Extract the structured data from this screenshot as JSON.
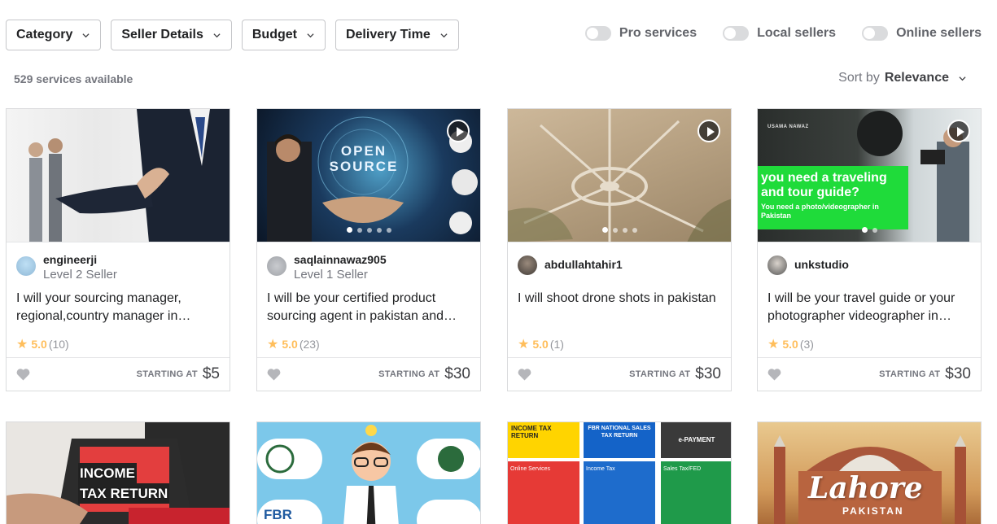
{
  "filters": [
    {
      "label": "Category"
    },
    {
      "label": "Seller Details"
    },
    {
      "label": "Budget"
    },
    {
      "label": "Delivery Time"
    }
  ],
  "toggles": [
    {
      "label": "Pro services"
    },
    {
      "label": "Local sellers"
    },
    {
      "label": "Online sellers"
    }
  ],
  "results_count": "529 services available",
  "sort": {
    "prefix": "Sort by",
    "value": "Relevance"
  },
  "price_prefix": "STARTING AT",
  "cards": [
    {
      "seller": "engineerji",
      "level": "Level 2 Seller",
      "title": "I will your sourcing manager, regional,country manager in pakistan",
      "score": "5.0",
      "count": "(10)",
      "price": "$5"
    },
    {
      "seller": "saqlainnawaz905",
      "level": "Level 1 Seller",
      "title": "I will be your certified product sourcing agent in pakistan and china",
      "score": "5.0",
      "count": "(23)",
      "price": "$30",
      "thumb_text": {
        "line1": "OPEN",
        "line2": "SOURCE"
      }
    },
    {
      "seller": "abdullahtahir1",
      "level": "",
      "title": "I will shoot drone shots in pakistan",
      "score": "5.0",
      "count": "(1)",
      "price": "$30"
    },
    {
      "seller": "unkstudio",
      "level": "",
      "title": "I will be your travel guide or your photographer videographer in pakistan",
      "score": "5.0",
      "count": "(3)",
      "price": "$30",
      "thumb_text": {
        "brand": "USAMA NAWAZ",
        "headline": "you need a traveling and tour guide?",
        "sub": "You need a photo/videographer in Pakistan"
      }
    }
  ],
  "row2": [
    {
      "thumb_text": {
        "line1": "INCOME",
        "line2": "TAX RETURN"
      }
    },
    {
      "thumb_text": {
        "line1": "FBR"
      }
    },
    {
      "thumb_text": {
        "h1": "INCOME TAX RETURN",
        "h2": "FBR NATIONAL SALES TAX RETURN",
        "h3": "e-PAYMENT",
        "c1": "Online Services",
        "c2": "Income Tax",
        "c3": "Sales Tax/FED"
      }
    },
    {
      "thumb_text": {
        "line1": "Lahore",
        "line2": "PAKISTAN"
      }
    }
  ],
  "colors": {
    "star": "#ffbe5b",
    "border": "#dadbdd",
    "text": "#404145"
  }
}
